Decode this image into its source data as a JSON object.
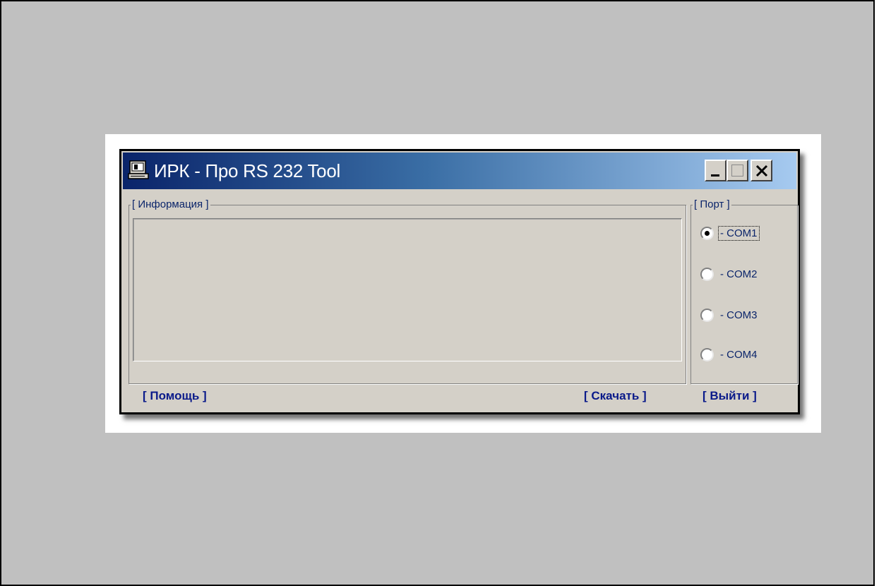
{
  "window": {
    "title": "ИРК - Про RS 232 Tool",
    "app_icon": "terminal-icon",
    "controls": {
      "minimize": "minimize-icon",
      "maximize": "maximize-icon",
      "close": "close-icon"
    }
  },
  "info": {
    "legend": "[ Информация ]",
    "content": ""
  },
  "port": {
    "legend": "[ Порт ]",
    "selected": "- COM1",
    "options": [
      {
        "label": "- COM1",
        "checked": true
      },
      {
        "label": "- COM2",
        "checked": false
      },
      {
        "label": "- COM3",
        "checked": false
      },
      {
        "label": "- COM4",
        "checked": false
      }
    ]
  },
  "footer": {
    "help": "[ Помощь ]",
    "download": "[ Скачать ]",
    "exit": "[ Выйти ]"
  },
  "colors": {
    "title_start": "#0a246a",
    "title_end": "#a6caf0",
    "window_bg": "#d4d0c8",
    "label_color": "#0a246a",
    "slide_bg": "#c0c0c0"
  }
}
